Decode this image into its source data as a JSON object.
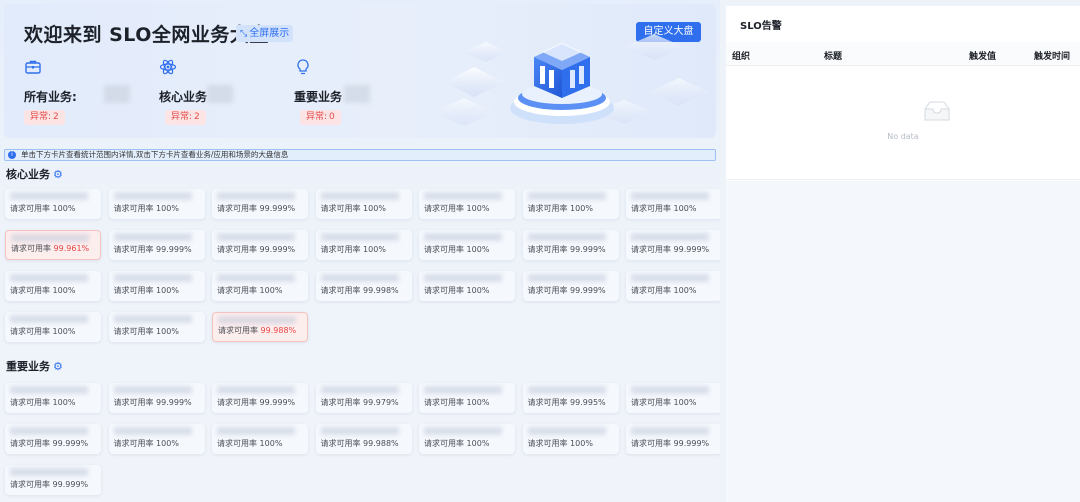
{
  "banner": {
    "title": "欢迎来到 SLO全网业务大盘",
    "fullscreen_label": "全屏展示",
    "custom_button": "自定义大盘",
    "stats": [
      {
        "icon": "briefcase-icon",
        "label": "所有业务:",
        "badge_label": "异常:",
        "badge_value": "2"
      },
      {
        "icon": "atom-icon",
        "label": "核心业务",
        "badge_label": "异常:",
        "badge_value": "2"
      },
      {
        "icon": "lightbulb-icon",
        "label": "重要业务",
        "badge_label": "异常:",
        "badge_value": "0"
      }
    ]
  },
  "tip": "单击下方卡片查看统计范围内详情,双击下方卡片查看业务/应用和场景的大盘信息",
  "core": {
    "title": "核心业务",
    "cards": [
      {
        "label": "请求可用率",
        "value": "100%",
        "alert": false
      },
      {
        "label": "请求可用率",
        "value": "100%",
        "alert": false
      },
      {
        "label": "请求可用率",
        "value": "99.999%",
        "alert": false
      },
      {
        "label": "请求可用率",
        "value": "100%",
        "alert": false
      },
      {
        "label": "请求可用率",
        "value": "100%",
        "alert": false
      },
      {
        "label": "请求可用率",
        "value": "100%",
        "alert": false
      },
      {
        "label": "请求可用率",
        "value": "100%",
        "alert": false
      },
      {
        "label": "请求可用率",
        "value": "99.961%",
        "alert": true
      },
      {
        "label": "请求可用率",
        "value": "99.999%",
        "alert": false
      },
      {
        "label": "请求可用率",
        "value": "99.999%",
        "alert": false
      },
      {
        "label": "请求可用率",
        "value": "100%",
        "alert": false
      },
      {
        "label": "请求可用率",
        "value": "100%",
        "alert": false
      },
      {
        "label": "请求可用率",
        "value": "99.999%",
        "alert": false
      },
      {
        "label": "请求可用率",
        "value": "99.999%",
        "alert": false
      },
      {
        "label": "请求可用率",
        "value": "100%",
        "alert": false
      },
      {
        "label": "请求可用率",
        "value": "100%",
        "alert": false
      },
      {
        "label": "请求可用率",
        "value": "100%",
        "alert": false
      },
      {
        "label": "请求可用率",
        "value": "99.998%",
        "alert": false
      },
      {
        "label": "请求可用率",
        "value": "100%",
        "alert": false
      },
      {
        "label": "请求可用率",
        "value": "99.999%",
        "alert": false
      },
      {
        "label": "请求可用率",
        "value": "100%",
        "alert": false
      },
      {
        "label": "请求可用率",
        "value": "100%",
        "alert": false
      },
      {
        "label": "请求可用率",
        "value": "100%",
        "alert": false
      },
      {
        "label": "请求可用率",
        "value": "99.988%",
        "alert": true
      }
    ]
  },
  "important": {
    "title": "重要业务",
    "cards": [
      {
        "label": "请求可用率",
        "value": "100%",
        "alert": false
      },
      {
        "label": "请求可用率",
        "value": "99.999%",
        "alert": false
      },
      {
        "label": "请求可用率",
        "value": "99.999%",
        "alert": false
      },
      {
        "label": "请求可用率",
        "value": "99.979%",
        "alert": false
      },
      {
        "label": "请求可用率",
        "value": "100%",
        "alert": false
      },
      {
        "label": "请求可用率",
        "value": "99.995%",
        "alert": false
      },
      {
        "label": "请求可用率",
        "value": "100%",
        "alert": false
      },
      {
        "label": "请求可用率",
        "value": "99.999%",
        "alert": false
      },
      {
        "label": "请求可用率",
        "value": "100%",
        "alert": false
      },
      {
        "label": "请求可用率",
        "value": "100%",
        "alert": false
      },
      {
        "label": "请求可用率",
        "value": "99.988%",
        "alert": false
      },
      {
        "label": "请求可用率",
        "value": "100%",
        "alert": false
      },
      {
        "label": "请求可用率",
        "value": "100%",
        "alert": false
      },
      {
        "label": "请求可用率",
        "value": "99.999%",
        "alert": false
      },
      {
        "label": "请求可用率",
        "value": "99.999%",
        "alert": false
      }
    ]
  },
  "alerts": {
    "title": "SLO告警",
    "columns": [
      "组织",
      "标题",
      "触发值",
      "触发时间"
    ],
    "empty_text": "No data"
  },
  "colors": {
    "accent": "#2f6fed",
    "alert": "#e84545"
  }
}
